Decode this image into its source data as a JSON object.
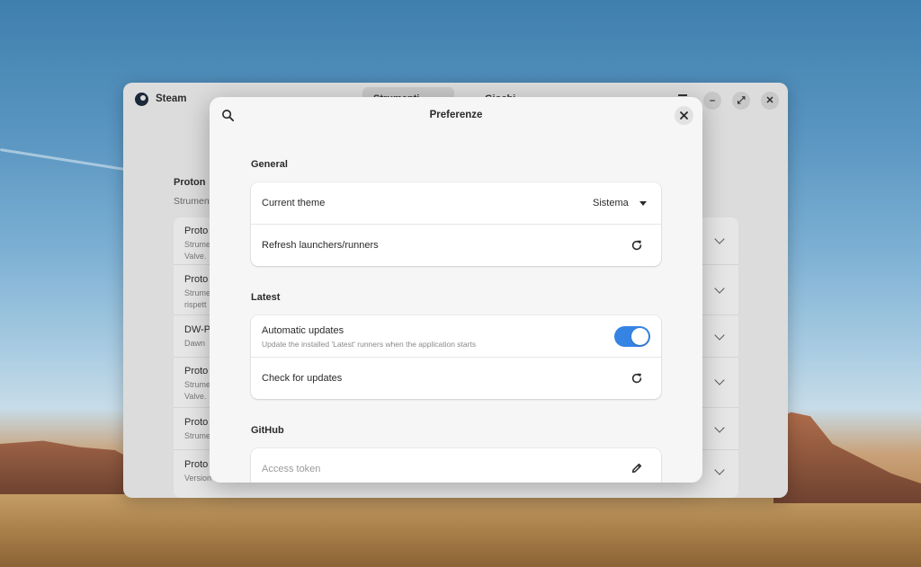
{
  "steam_window": {
    "title": "Steam",
    "tabs": [
      {
        "label": "Strumenti"
      },
      {
        "label": "Giochi"
      }
    ],
    "section_title": "Proton",
    "section_subtitle": "Strumenti",
    "rows": [
      {
        "title": "Proto",
        "sub": "Strume\nValve."
      },
      {
        "title": "Proto",
        "sub": "Strume\nrispett"
      },
      {
        "title": "DW-P",
        "sub": "Dawn"
      },
      {
        "title": "Proto",
        "sub": "Strume\nValve."
      },
      {
        "title": "Proto",
        "sub": "Strume"
      },
      {
        "title": "Proto",
        "sub": "Version"
      }
    ]
  },
  "dialog": {
    "title": "Preferenze",
    "general": {
      "title": "General",
      "current_theme_label": "Current theme",
      "current_theme_value": "Sistema",
      "refresh_label": "Refresh launchers/runners"
    },
    "latest": {
      "title": "Latest",
      "auto_updates_label": "Automatic updates",
      "auto_updates_desc": "Update the installed 'Latest' runners when the application starts",
      "auto_updates_enabled": true,
      "check_updates_label": "Check for updates"
    },
    "github": {
      "title": "GitHub",
      "access_token_placeholder": "Access token"
    }
  },
  "colors": {
    "accent": "#3584e4",
    "dialog_bg": "#f6f6f6",
    "card_bg": "#ffffff"
  },
  "icons": [
    "search-icon",
    "close-icon",
    "chevron-down-icon",
    "refresh-icon",
    "pencil-icon",
    "steam-logo-icon"
  ]
}
